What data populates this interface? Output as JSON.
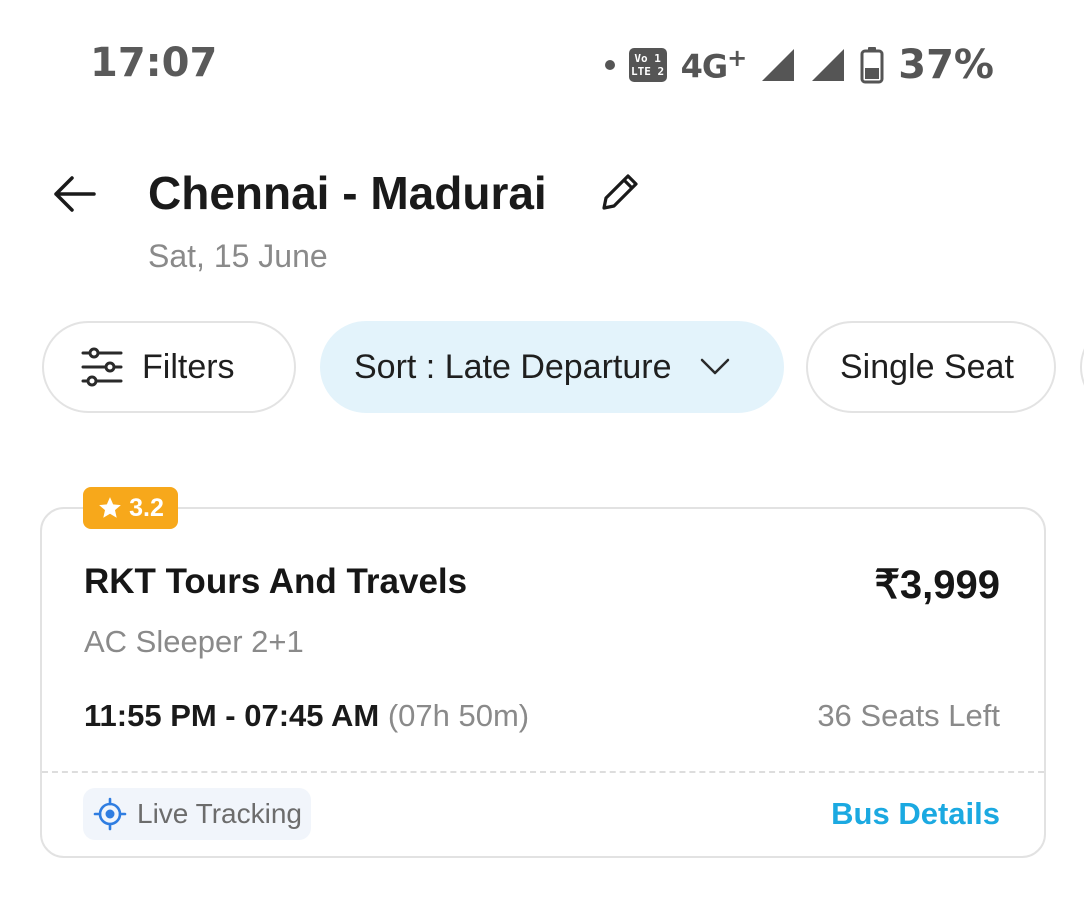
{
  "status_bar": {
    "time": "17:07",
    "volte_top": "Vo 1",
    "volte_bottom": "LTE 2",
    "network": "4G",
    "network_plus": "+",
    "battery": "37%"
  },
  "header": {
    "title": "Chennai - Madurai",
    "date": "Sat, 15 June"
  },
  "chips": {
    "filters": "Filters",
    "sort": "Sort : Late Departure",
    "single_seat": "Single Seat"
  },
  "bus": {
    "rating": "3.2",
    "operator": "RKT Tours And Travels",
    "price": "₹3,999",
    "type": "AC Sleeper 2+1",
    "times": "11:55 PM - 07:45 AM",
    "duration": "(07h 50m)",
    "seats_left": "36 Seats Left",
    "live_tracking": "Live Tracking",
    "details_link": "Bus Details"
  },
  "colors": {
    "accent_link": "#1ba9e1",
    "rating_badge": "#f7a81b",
    "sort_chip_bg": "#e3f3fb",
    "tracking_icon": "#2f7de1"
  }
}
